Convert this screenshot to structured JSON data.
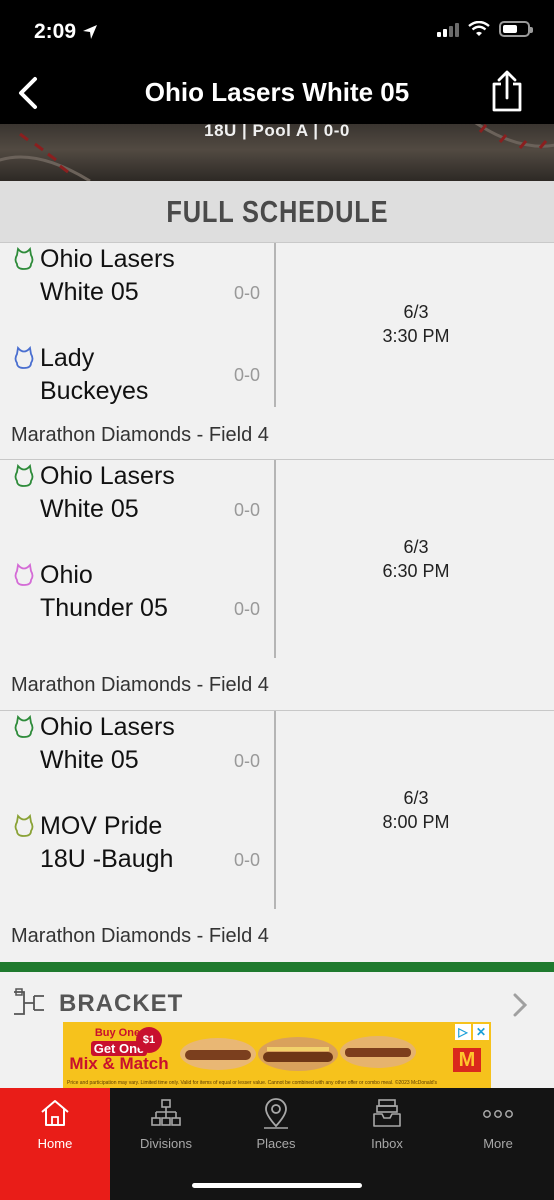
{
  "status_bar": {
    "time": "2:09"
  },
  "nav": {
    "title": "Ohio Lasers White 05"
  },
  "hero": {
    "subtitle": "18U | Pool A | 0-0"
  },
  "schedule": {
    "header": "FULL SCHEDULE",
    "games": [
      {
        "home": {
          "name": "Ohio Lasers White 05",
          "score": "0-0",
          "color": "#2e8b3a"
        },
        "away": {
          "name": "Lady Buckeyes",
          "score": "0-0",
          "color": "#4a6fd0"
        },
        "date": "6/3",
        "time": "3:30 PM",
        "location": "Marathon Diamonds - Field 4"
      },
      {
        "home": {
          "name": "Ohio Lasers White 05",
          "score": "0-0",
          "color": "#2e8b3a"
        },
        "away": {
          "name": "Ohio Thunder 05",
          "score": "0-0",
          "color": "#d46bd6"
        },
        "date": "6/3",
        "time": "6:30 PM",
        "location": "Marathon Diamonds - Field 4"
      },
      {
        "home": {
          "name": "Ohio Lasers White 05",
          "score": "0-0",
          "color": "#2e8b3a"
        },
        "away": {
          "name": "MOV Pride 18U -Baugh",
          "score": "0-0",
          "color": "#8aa236"
        },
        "date": "6/3",
        "time": "8:00 PM",
        "location": "Marathon Diamonds - Field 4"
      }
    ]
  },
  "bracket": {
    "label": "BRACKET"
  },
  "ad": {
    "line1": "Buy One,",
    "line2": "Get One",
    "line3": "Mix & Match",
    "price": "$1",
    "fine_print": "Price and participation may vary. Limited time only. Valid for items of equal or lesser value. Cannot be combined with any other offer or combo meal. ©2023 McDonald's",
    "logo": "M"
  },
  "tabs": [
    {
      "label": "Home",
      "icon": "home-icon",
      "active": true
    },
    {
      "label": "Divisions",
      "icon": "divisions-icon",
      "active": false
    },
    {
      "label": "Places",
      "icon": "places-icon",
      "active": false
    },
    {
      "label": "Inbox",
      "icon": "inbox-icon",
      "active": false
    },
    {
      "label": "More",
      "icon": "more-icon",
      "active": false
    }
  ],
  "colors": {
    "accent": "#e91d18",
    "green": "#1f7a2e",
    "nav_bg": "#000000"
  }
}
